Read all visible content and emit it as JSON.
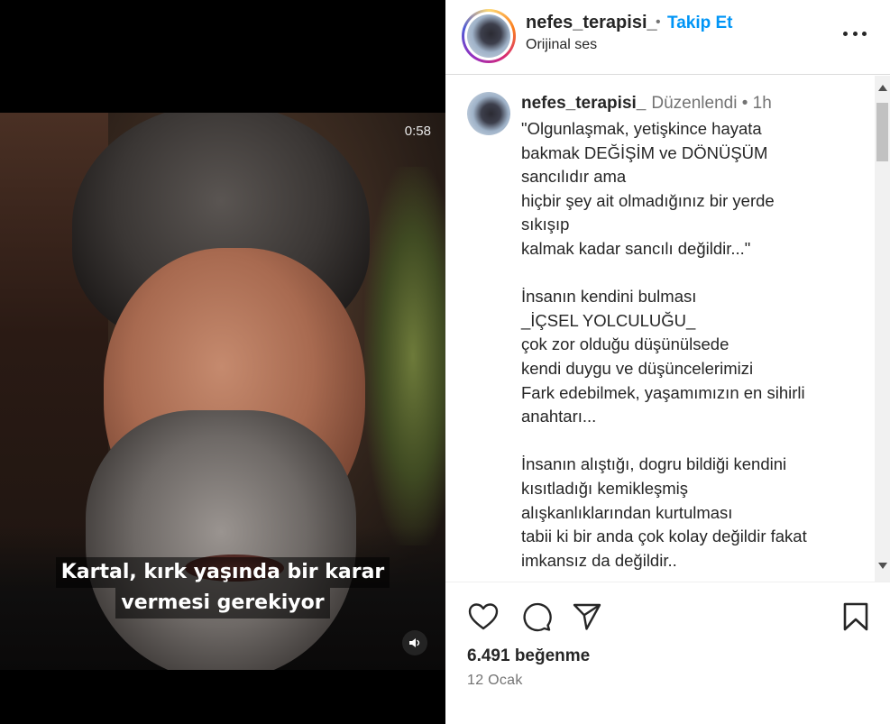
{
  "video": {
    "time_remaining": "0:58",
    "subtitle_line1": "Kartal, kırk yaşında bir karar",
    "subtitle_line2": "vermesi gerekiyor",
    "mute_icon": "volume-icon"
  },
  "header": {
    "username": "nefes_terapisi_",
    "separator": "•",
    "follow_label": "Takip Et",
    "audio_label": "Orijinal ses",
    "more_icon": "more-horizontal-icon"
  },
  "caption": {
    "username": "nefes_terapisi_",
    "meta": "Düzenlendi •  1h",
    "lines": [
      "\"Olgunlaşmak, yetişkince hayata",
      "bakmak DEĞİŞİM ve DÖNÜŞÜM",
      "sancılıdır ama",
      "hiçbir şey ait olmadığınız bir yerde",
      "sıkışıp",
      "kalmak kadar sancılı değildir...\"",
      "",
      "İnsanın kendini bulması",
      "_İÇSEL YOLCULUĞU_",
      "çok zor olduğu düşünülsede",
      "kendi duygu ve düşüncelerimizi",
      "Fark edebilmek, yaşamımızın en sihirli",
      "anahtarı...",
      "",
      "İnsanın alıştığı, dogru bildiği kendini",
      "kısıtladığı kemikleşmiş",
      "alışkanlıklarından kurtulması",
      "tabii ki bir anda çok kolay değildir fakat",
      "imkansız da değildir.."
    ]
  },
  "actions": {
    "like_icon": "heart-icon",
    "comment_icon": "comment-icon",
    "share_icon": "share-icon",
    "save_icon": "bookmark-icon"
  },
  "stats": {
    "likes": "6.491 beğenme",
    "date": "12 Ocak"
  },
  "colors": {
    "accent": "#0095f6",
    "secondary_text": "#737373",
    "primary_text": "#262626"
  }
}
